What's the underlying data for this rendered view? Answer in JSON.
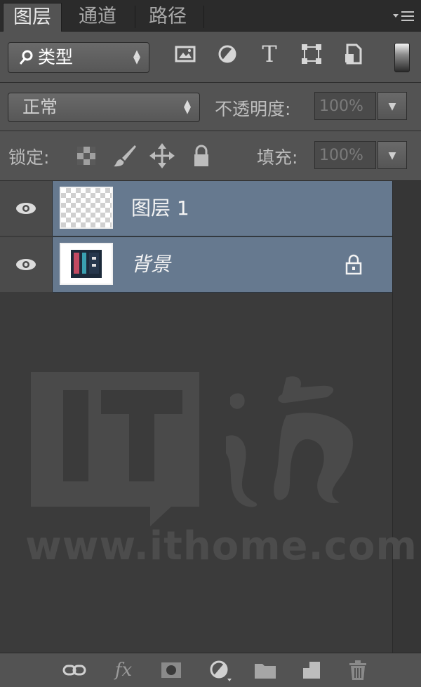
{
  "tabs": [
    {
      "label": "图层",
      "active": true
    },
    {
      "label": "通道",
      "active": false
    },
    {
      "label": "路径",
      "active": false
    }
  ],
  "panel_menu_icon": "panel-menu-icon",
  "filter": {
    "kind_label": "类型",
    "icons": [
      "image-filter-icon",
      "adjustment-filter-icon",
      "type-filter-icon",
      "shape-filter-icon",
      "smart-object-filter-icon"
    ]
  },
  "blend": {
    "mode": "正常",
    "opacity_label": "不透明度:",
    "opacity_value": "100%"
  },
  "lock": {
    "label": "锁定:",
    "fill_label": "填充:",
    "fill_value": "100%",
    "icons": [
      "lock-transparent-icon",
      "lock-image-icon",
      "lock-position-icon",
      "lock-all-icon"
    ]
  },
  "layers": [
    {
      "name": "图层 1",
      "visible": true,
      "thumbnail": "transparent",
      "locked": false
    },
    {
      "name": "背景",
      "visible": true,
      "thumbnail": "image",
      "locked": true
    }
  ],
  "watermark": {
    "brand": "IT之家",
    "url": "www.ithome.com"
  },
  "bottom_icons": [
    "link-layers-icon",
    "fx-icon",
    "add-mask-icon",
    "adjustment-layer-icon",
    "new-group-icon",
    "new-layer-icon",
    "delete-layer-icon"
  ],
  "colors": {
    "panel_bg": "#535353",
    "selected_layer": "#66798f",
    "list_bg": "#3b3b3b"
  }
}
